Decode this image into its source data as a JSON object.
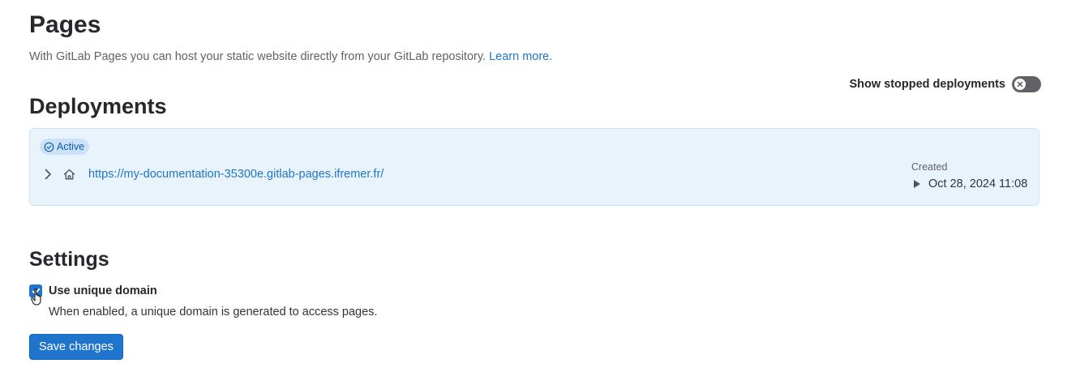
{
  "header": {
    "title": "Pages",
    "description": "With GitLab Pages you can host your static website directly from your GitLab repository.",
    "learn_more": "Learn more."
  },
  "toggle": {
    "label": "Show stopped deployments",
    "enabled": false
  },
  "deployments": {
    "title": "Deployments",
    "items": [
      {
        "status": "Active",
        "url": "https://my-documentation-35300e.gitlab-pages.ifremer.fr/",
        "created_label": "Created",
        "created_date": "Oct 28, 2024 11:08"
      }
    ]
  },
  "settings": {
    "title": "Settings",
    "unique_domain_label": "Use unique domain",
    "unique_domain_help": "When enabled, a unique domain is generated to access pages.",
    "unique_domain_checked": true,
    "save_label": "Save changes"
  },
  "colors": {
    "accent": "#1f75cb",
    "card_bg": "#e9f3fc",
    "badge_bg": "#cbe2f9"
  }
}
